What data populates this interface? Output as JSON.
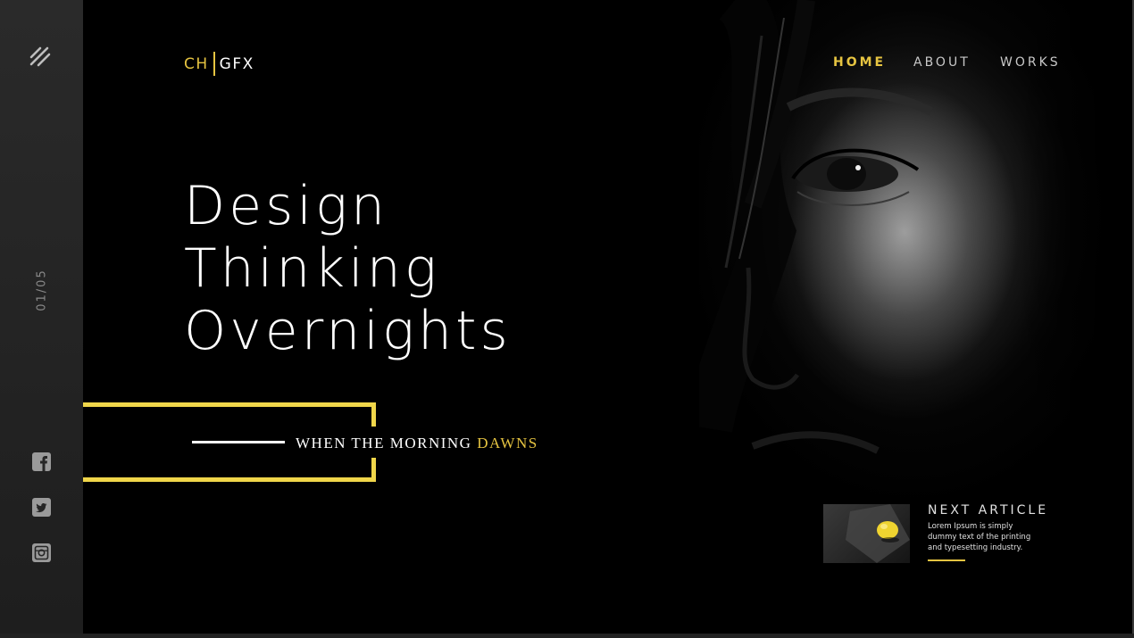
{
  "brand": {
    "left": "CH",
    "right": "GFX"
  },
  "nav": {
    "items": [
      "HOME",
      "ABOUT",
      "WORKS"
    ],
    "active": "HOME"
  },
  "sidebar": {
    "menu_icon": "slash-menu-icon",
    "pager": "01/05",
    "social": [
      "facebook-icon",
      "twitter-icon",
      "instagram-icon"
    ]
  },
  "hero": {
    "lines": [
      "Design",
      "Thinking",
      "Overnights"
    ],
    "tagline_prefix": "WHEN THE MORNING ",
    "tagline_accent": "DAWNS"
  },
  "next_article": {
    "title": "NEXT ARTICLE",
    "text": "Lorem Ipsum is simply dummy text of the printing and typesetting industry."
  },
  "colors": {
    "accent": "#e6c441",
    "frame": "#f0d64a",
    "sidebar": "#262626",
    "background": "#000000"
  }
}
